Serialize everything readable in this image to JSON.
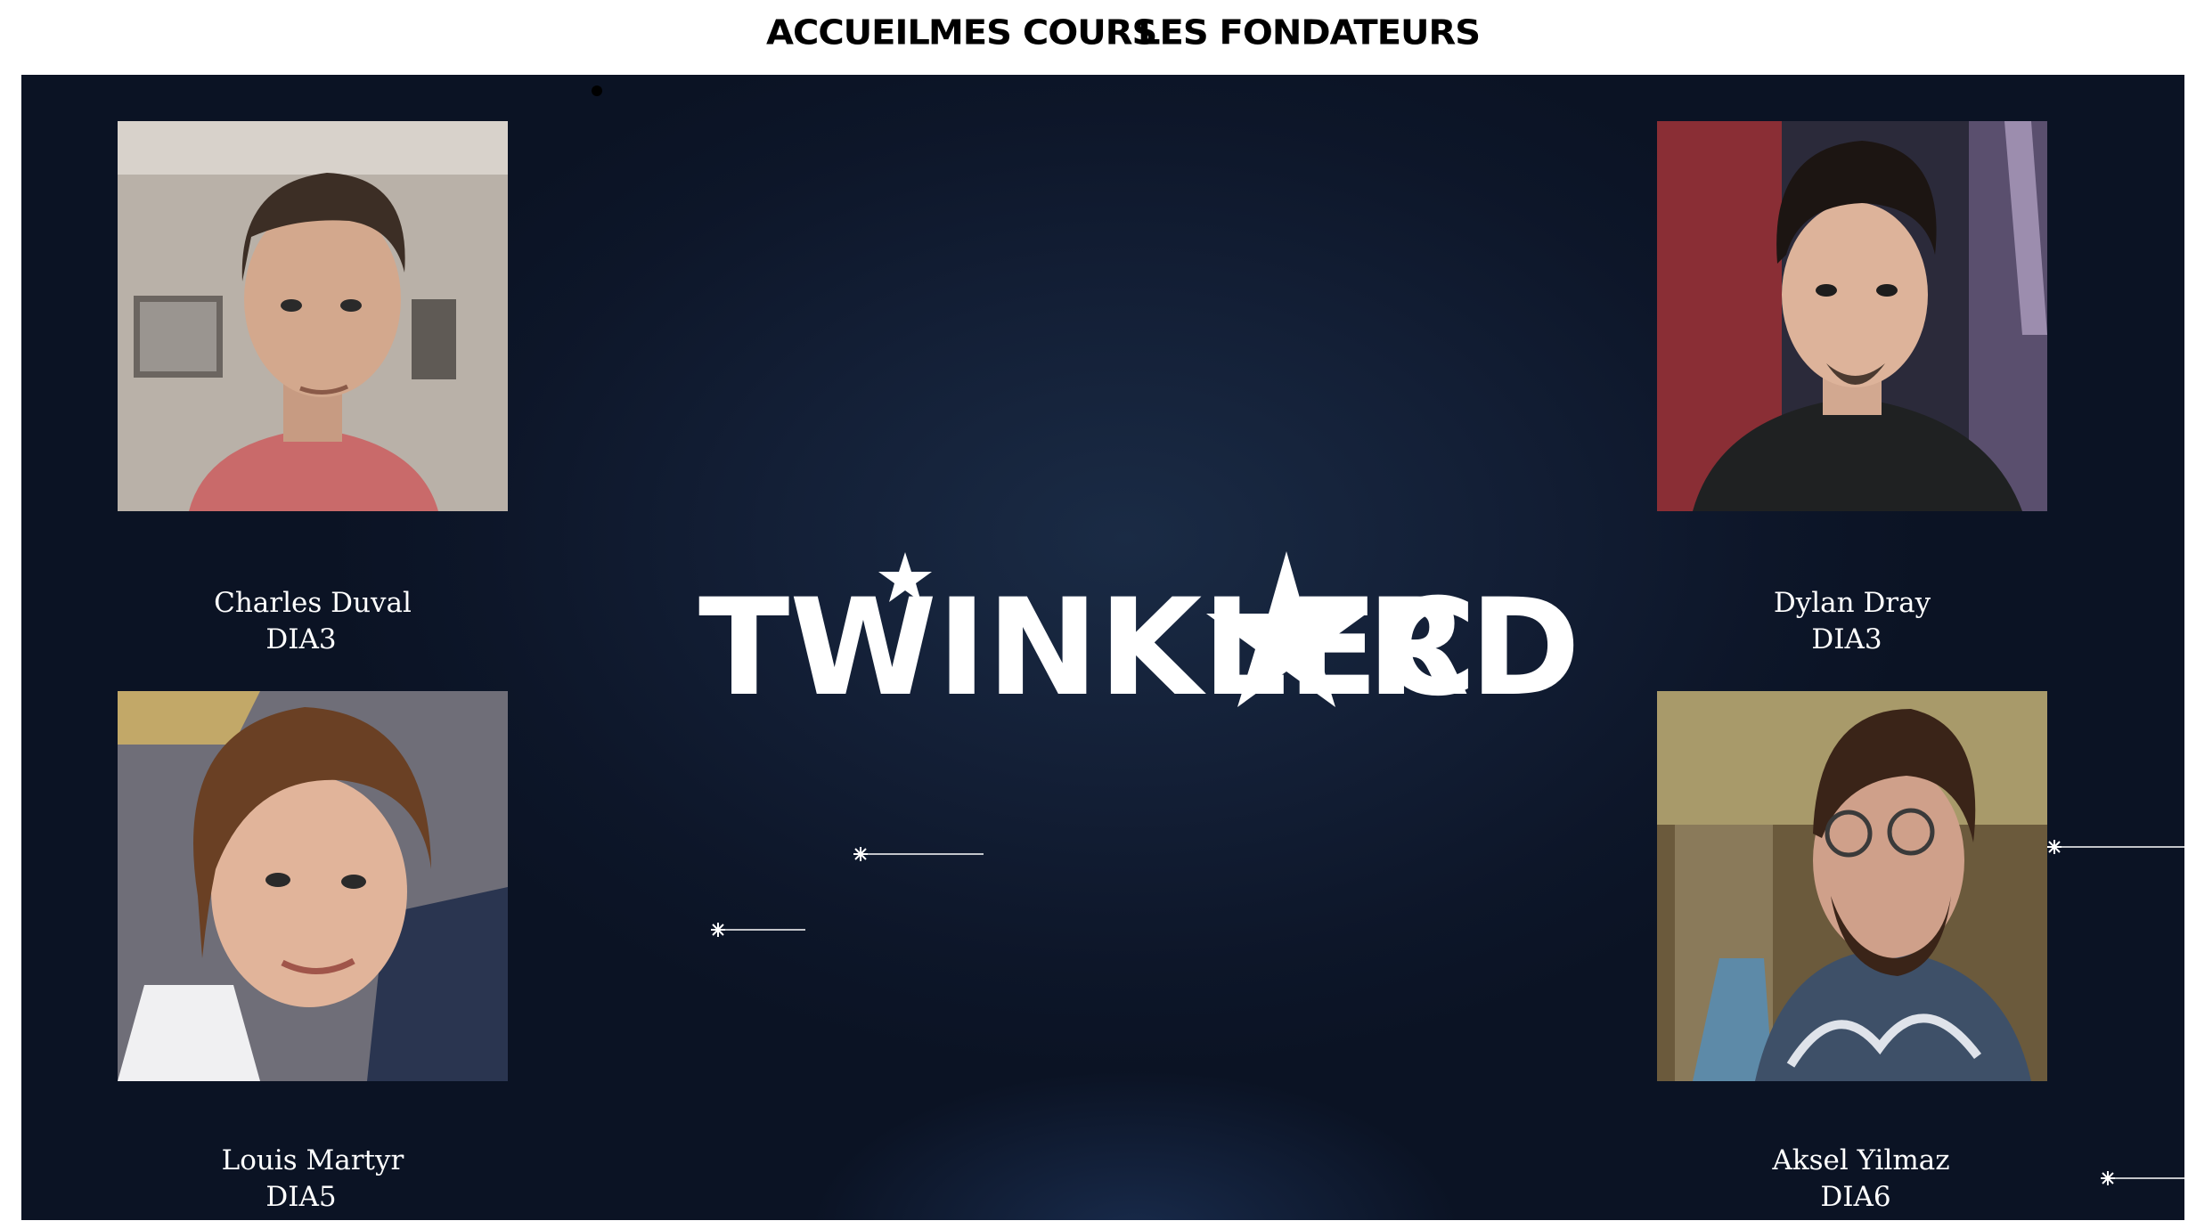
{
  "nav": {
    "links": [
      "Accueil",
      "Mes cours",
      "Les fondateurs"
    ]
  },
  "logo": {
    "text": "TWINKLECARD",
    "part_left": "TWINKLEC",
    "part_right": "RD"
  },
  "founders": [
    {
      "name": "Charles Duval",
      "class": "DIA3"
    },
    {
      "name": "Dylan Dray",
      "class": "DIA3"
    },
    {
      "name": "Louis Martyr",
      "class": "DIA5"
    },
    {
      "name": "Aksel Yilmaz",
      "class": "DIA6"
    }
  ],
  "colors": {
    "background": "#0e1a2e",
    "nav_text": "#000000",
    "text": "#ffffff"
  }
}
